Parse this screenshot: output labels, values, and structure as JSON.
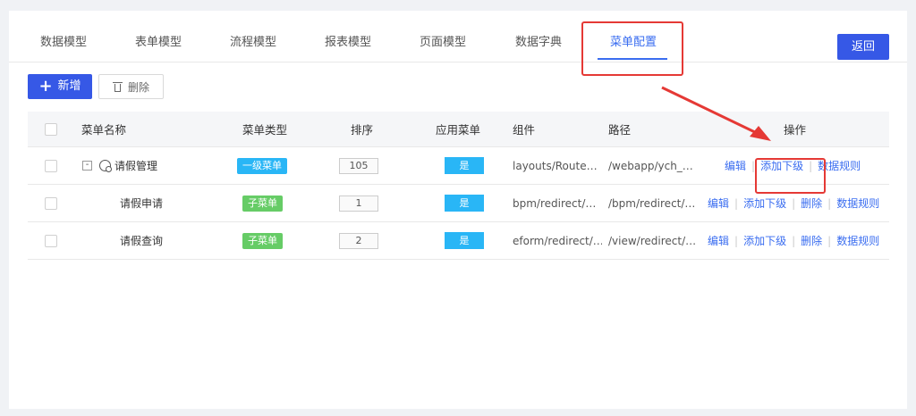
{
  "tabs": [
    {
      "label": "数据模型",
      "active": false
    },
    {
      "label": "表单模型",
      "active": false
    },
    {
      "label": "流程模型",
      "active": false
    },
    {
      "label": "报表模型",
      "active": false
    },
    {
      "label": "页面模型",
      "active": false
    },
    {
      "label": "数据字典",
      "active": false
    },
    {
      "label": "菜单配置",
      "active": true
    }
  ],
  "toolbar": {
    "back_label": "返回",
    "add_label": "新增",
    "delete_label": "删除"
  },
  "table": {
    "headers": {
      "name": "菜单名称",
      "type": "菜单类型",
      "order": "排序",
      "app_menu": "应用菜单",
      "component": "组件",
      "path": "路径",
      "actions": "操作"
    },
    "rows": [
      {
        "name": "请假管理",
        "type": "一级菜单",
        "order": "105",
        "app_menu": "是",
        "component": "layouts/Route…",
        "path": "/webapp/ych_…",
        "actions": [
          "编辑",
          "添加下级",
          "数据规则"
        ]
      },
      {
        "name": "请假申请",
        "type": "子菜单",
        "order": "1",
        "app_menu": "是",
        "component": "bpm/redirect/…",
        "path": "/bpm/redirect/…",
        "actions": [
          "编辑",
          "添加下级",
          "删除",
          "数据规则"
        ]
      },
      {
        "name": "请假查询",
        "type": "子菜单",
        "order": "2",
        "app_menu": "是",
        "component": "eform/redirect/…",
        "path": "/view/redirect/…",
        "actions": [
          "编辑",
          "添加下级",
          "删除",
          "数据规则"
        ]
      }
    ]
  },
  "colors": {
    "primary": "#3658e6",
    "link": "#3a6df0",
    "badge_level1": "#29b6f6",
    "badge_child": "#66cc66",
    "annotation": "#e53935"
  }
}
